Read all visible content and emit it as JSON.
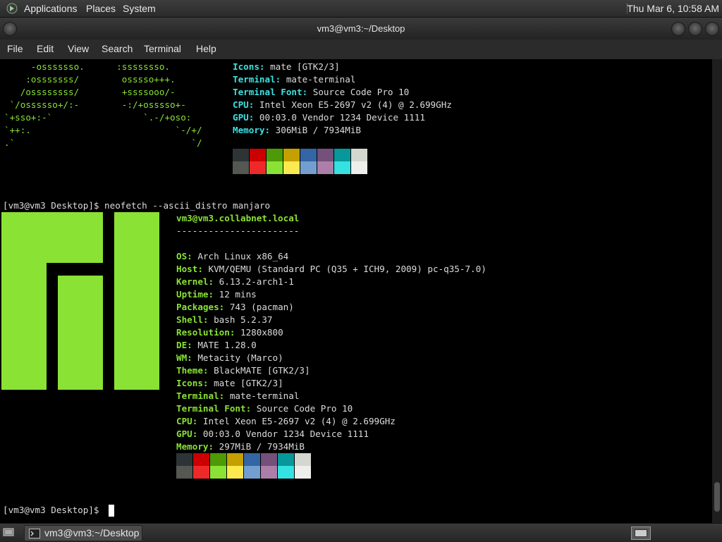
{
  "top_panel": {
    "menus": [
      "Applications",
      "Places",
      "System"
    ],
    "clock": "Thu Mar  6, 10:58 AM"
  },
  "window": {
    "title": "vm3@vm3:~/Desktop",
    "menu": [
      "File",
      "Edit",
      "View",
      "Search",
      "Terminal",
      "Help"
    ]
  },
  "terminal": {
    "prev_ascii": [
      "     -osssssso.      :ssssssso.       ",
      "    :osssssss/        osssso+++.      ",
      "   /ossssssss/        +ssssooo/-      ",
      " `/ossssso+/:-        -:/+osssso+-    ",
      "`+sso+:-`                 `.-/+oso:   ",
      "`++:.                           `-/+/ ",
      ".`                                 `/ "
    ],
    "prev_info": [
      {
        "label": "Icons",
        "value": "mate [GTK2/3]"
      },
      {
        "label": "Terminal",
        "value": "mate-terminal"
      },
      {
        "label": "Terminal Font",
        "value": "Source Code Pro 10"
      },
      {
        "label": "CPU",
        "value": "Intel Xeon E5-2697 v2 (4) @ 2.699GHz"
      },
      {
        "label": "GPU",
        "value": "00:03.0 Vendor 1234 Device 1111"
      },
      {
        "label": "Memory",
        "value": "306MiB / 7934MiB"
      }
    ],
    "command_line": "[vm3@vm3 Desktop]$ neofetch --ascii_distro manjaro",
    "user_host": "vm3@vm3.collabnet.local",
    "separator": "-----------------------",
    "info": [
      {
        "label": "OS",
        "value": "Arch Linux x86_64"
      },
      {
        "label": "Host",
        "value": "KVM/QEMU (Standard PC (Q35 + ICH9, 2009) pc-q35-7.0)"
      },
      {
        "label": "Kernel",
        "value": "6.13.2-arch1-1"
      },
      {
        "label": "Uptime",
        "value": "12 mins"
      },
      {
        "label": "Packages",
        "value": "743 (pacman)"
      },
      {
        "label": "Shell",
        "value": "bash 5.2.37"
      },
      {
        "label": "Resolution",
        "value": "1280x800"
      },
      {
        "label": "DE",
        "value": "MATE 1.28.0"
      },
      {
        "label": "WM",
        "value": "Metacity (Marco)"
      },
      {
        "label": "Theme",
        "value": "BlackMATE [GTK2/3]"
      },
      {
        "label": "Icons",
        "value": "mate [GTK2/3]"
      },
      {
        "label": "Terminal",
        "value": "mate-terminal"
      },
      {
        "label": "Terminal Font",
        "value": "Source Code Pro 10"
      },
      {
        "label": "CPU",
        "value": "Intel Xeon E5-2697 v2 (4) @ 2.699GHz"
      },
      {
        "label": "GPU",
        "value": "00:03.0 Vendor 1234 Device 1111"
      },
      {
        "label": "Memory",
        "value": "297MiB / 7934MiB"
      }
    ],
    "palette_dark": [
      "#2e3436",
      "#cc0000",
      "#4e9a06",
      "#c4a000",
      "#3465a4",
      "#75507b",
      "#06989a",
      "#d3d7cf"
    ],
    "palette_bright": [
      "#555753",
      "#ef2929",
      "#8ae234",
      "#fce94f",
      "#729fcf",
      "#ad7fa8",
      "#34e2e2",
      "#eeeeec"
    ],
    "prompt": "[vm3@vm3 Desktop]$ ",
    "logo_color": "#8ae234"
  },
  "bottom_panel": {
    "task_label": "vm3@vm3:~/Desktop"
  }
}
